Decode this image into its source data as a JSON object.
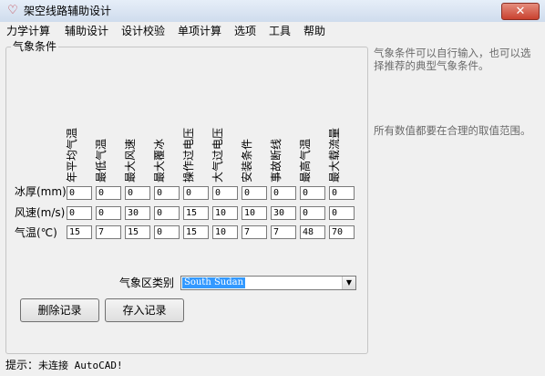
{
  "window": {
    "title": "架空线路辅助设计",
    "close_glyph": "✕",
    "app_icon": "heart-leaf-icon"
  },
  "menu": [
    "力学计算",
    "辅助设计",
    "设计校验",
    "单项计算",
    "选项",
    "工具",
    "帮助"
  ],
  "weather": {
    "group_label": "气象条件",
    "columns": [
      "年平均气温",
      "最低气温",
      "最大风速",
      "最大覆冰",
      "操作过电压",
      "大气过电压",
      "安装条件",
      "事故断线",
      "最高气温",
      "最大载流量"
    ],
    "rows": [
      {
        "label": "冰厚(mm)",
        "values": [
          "0",
          "0",
          "0",
          "0",
          "0",
          "0",
          "0",
          "0",
          "0",
          "0"
        ]
      },
      {
        "label": "风速(m/s)",
        "values": [
          "0",
          "0",
          "30",
          "0",
          "15",
          "10",
          "10",
          "30",
          "0",
          "0"
        ]
      },
      {
        "label": "气温(℃)",
        "values": [
          "15",
          "7",
          "15",
          "0",
          "15",
          "10",
          "7",
          "7",
          "48",
          "70"
        ]
      }
    ],
    "zone_label": "气象区类别",
    "zone_value": "South Sudan",
    "delete_button": "删除记录",
    "save_button": "存入记录"
  },
  "help": {
    "text1": "气象条件可以自行输入，也可以选择推荐的典型气象条件。",
    "text2": "所有数值都要在合理的取值范围。"
  },
  "status": {
    "prefix": "提示：",
    "message": "未连接 AutoCAD!"
  }
}
